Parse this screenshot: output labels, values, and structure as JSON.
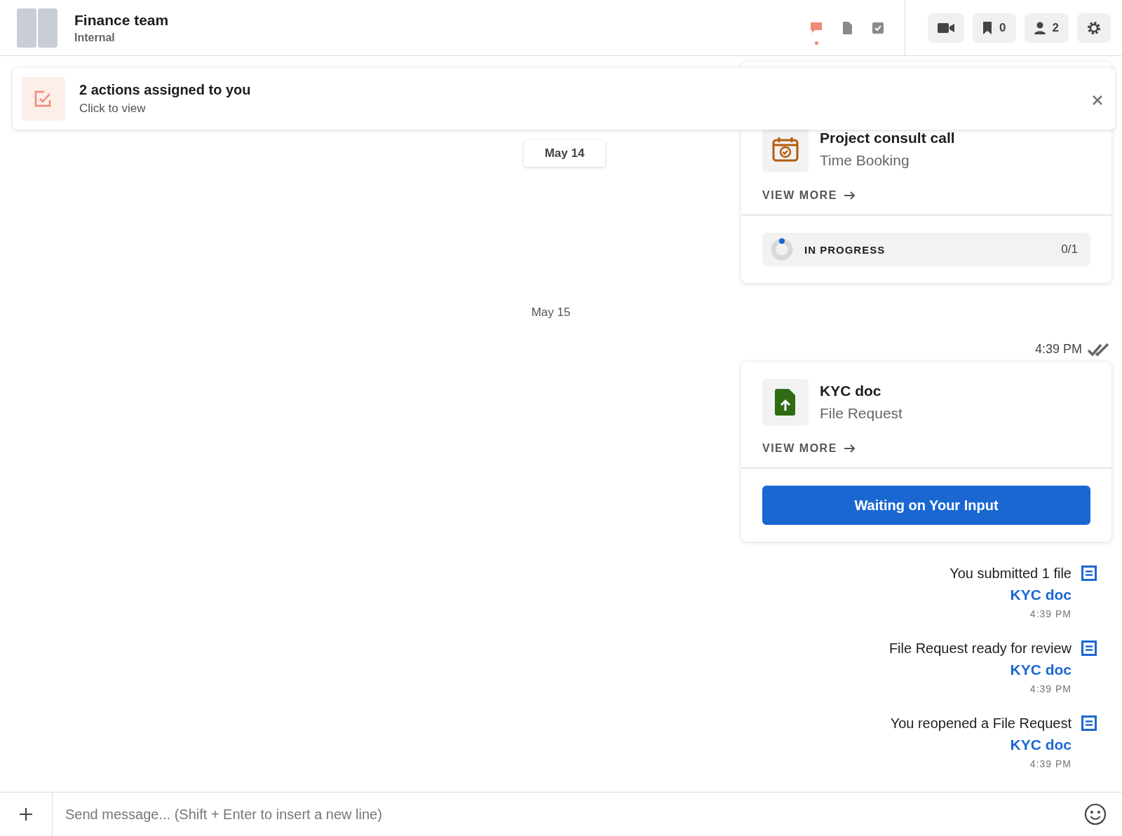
{
  "header": {
    "title": "Finance team",
    "subtitle": "Internal",
    "tabs": [
      {
        "selected": true
      },
      {
        "selected": false
      },
      {
        "selected": false
      }
    ],
    "actions": [
      {
        "kind": "video"
      },
      {
        "kind": "bookmark",
        "count": "0"
      },
      {
        "kind": "people",
        "count": "2"
      },
      {
        "kind": "settings"
      }
    ]
  },
  "notice": {
    "title": "2 actions assigned to you",
    "subtitle": "Click to view"
  },
  "sticky_date": "May 14",
  "stream": [
    {
      "kind": "booking_card",
      "title": "Project consult call",
      "subtitle": "Time Booking",
      "link": "VIEW MORE",
      "footer": {
        "kind": "progress",
        "label": "IN PROGRESS",
        "count": "0/1",
        "level": 0
      }
    },
    {
      "kind": "date",
      "text": "May 15"
    },
    {
      "kind": "time",
      "text": "4:39 PM"
    },
    {
      "kind": "file_request_card",
      "title": "KYC doc",
      "subtitle": "File Request",
      "link": "VIEW MORE",
      "footer": {
        "kind": "button",
        "label": "Waiting on Your Input"
      }
    },
    {
      "kind": "activity",
      "text": "You submitted 1 file",
      "link": "KYC doc",
      "time": "4:39 PM"
    },
    {
      "kind": "activity",
      "text": "File Request ready for review",
      "link": "KYC doc",
      "time": "4:39 PM"
    },
    {
      "kind": "activity",
      "text": "You reopened a File Request",
      "link": "KYC doc",
      "time": "4:39 PM"
    }
  ],
  "composer": {
    "placeholder": "Send message... (Shift + Enter to insert a new line)"
  }
}
